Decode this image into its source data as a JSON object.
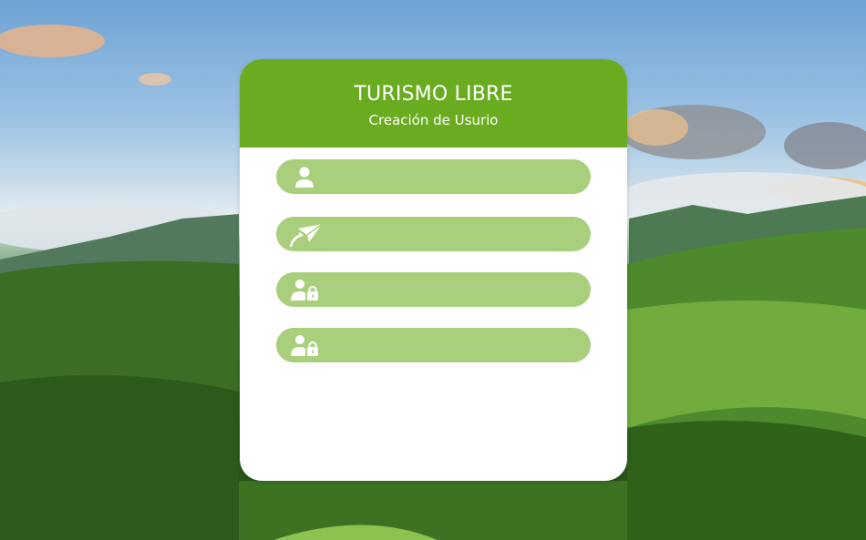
{
  "app": {
    "title": "TURISMO LIBRE",
    "subtitle": "Creación de Usurio"
  },
  "form": {
    "fields": [
      {
        "icon": "user-icon",
        "value": "",
        "placeholder": ""
      },
      {
        "icon": "paper-plane-icon",
        "value": "",
        "placeholder": ""
      },
      {
        "icon": "user-lock-icon",
        "value": "",
        "placeholder": ""
      },
      {
        "icon": "user-lock-icon",
        "value": "",
        "placeholder": ""
      }
    ]
  },
  "colors": {
    "header": "#6aac1f",
    "field": "#a9cf7d",
    "card": "#ffffff",
    "icon": "#ffffff"
  }
}
